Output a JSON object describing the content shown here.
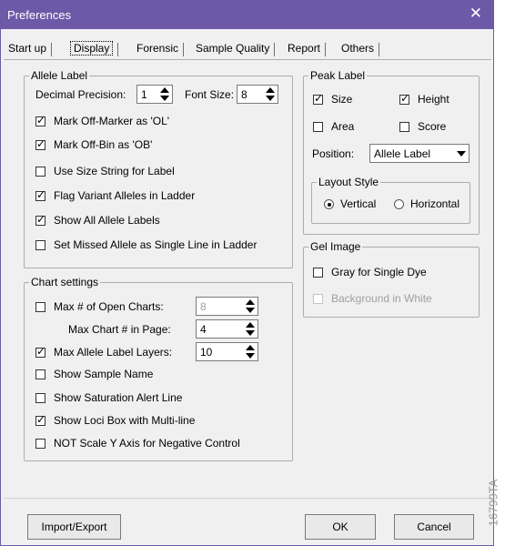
{
  "window": {
    "title": "Preferences",
    "close_glyph": "✕"
  },
  "tabs": [
    {
      "label": "Start up",
      "active": false
    },
    {
      "label": "Display",
      "active": true
    },
    {
      "label": "Forensic",
      "active": false
    },
    {
      "label": "Sample Quality",
      "active": false
    },
    {
      "label": "Report",
      "active": false
    },
    {
      "label": "Others",
      "active": false
    }
  ],
  "allele_label": {
    "legend": "Allele Label",
    "decimal_precision_label": "Decimal Precision:",
    "decimal_precision_value": "1",
    "font_size_label": "Font Size:",
    "font_size_value": "8",
    "options": [
      {
        "label": "Mark Off-Marker as 'OL'",
        "checked": true
      },
      {
        "label": "Mark Off-Bin as 'OB'",
        "checked": true
      },
      {
        "label": "Use Size String for Label",
        "checked": false
      },
      {
        "label": "Flag Variant Alleles in Ladder",
        "checked": true
      },
      {
        "label": "Show All Allele Labels",
        "checked": true
      },
      {
        "label": "Set Missed Allele as Single Line in Ladder",
        "checked": false
      }
    ]
  },
  "chart_settings": {
    "legend": "Chart settings",
    "max_open_charts_label": "Max # of Open Charts:",
    "max_open_charts_checked": false,
    "max_open_charts_value": "8",
    "max_chart_in_page_label": "Max Chart # in Page:",
    "max_chart_in_page_value": "4",
    "max_allele_layers_label": "Max Allele Label Layers:",
    "max_allele_layers_checked": true,
    "max_allele_layers_value": "10",
    "options": [
      {
        "label": "Show Sample Name",
        "checked": false
      },
      {
        "label": "Show Saturation Alert Line",
        "checked": false
      },
      {
        "label": "Show Loci Box with Multi-line",
        "checked": true
      },
      {
        "label": "NOT Scale Y Axis for Negative Control",
        "checked": false
      }
    ]
  },
  "peak_label": {
    "legend": "Peak Label",
    "size_label": "Size",
    "size_checked": true,
    "height_label": "Height",
    "height_checked": true,
    "area_label": "Area",
    "area_checked": false,
    "score_label": "Score",
    "score_checked": false,
    "position_label": "Position:",
    "position_value": "Allele Label",
    "layout_style": {
      "legend": "Layout Style",
      "vertical_label": "Vertical",
      "vertical_selected": true,
      "horizontal_label": "Horizontal",
      "horizontal_selected": false
    }
  },
  "gel_image": {
    "legend": "Gel Image",
    "gray_label": "Gray for Single Dye",
    "gray_checked": false,
    "background_label": "Background in White",
    "background_checked": false,
    "background_enabled": false
  },
  "buttons": {
    "import_export": "Import/Export",
    "ok": "OK",
    "cancel": "Cancel"
  },
  "figure_id": "16799TA",
  "colors": {
    "titlebar": "#6e58a8",
    "dialog_bg": "#f0f0f0"
  }
}
